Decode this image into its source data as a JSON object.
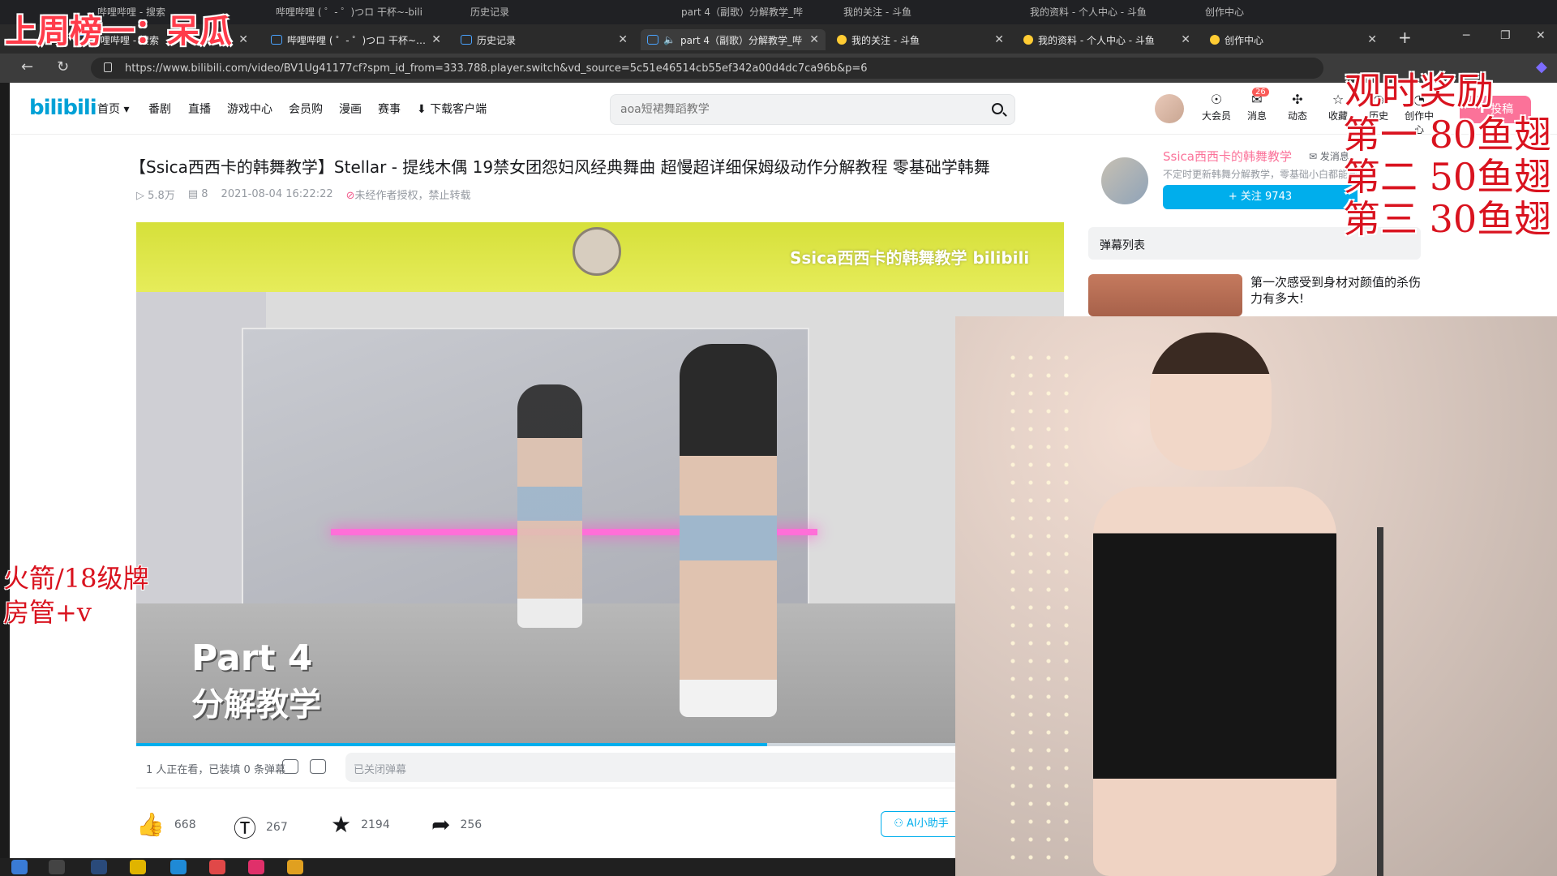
{
  "ghost_tabs": [
    "哔哩哔哩 - 搜索",
    "哔哩哔哩 ( ゜- ゜)つロ 干杯~-bili",
    "历史记录",
    "part 4（副歌）分解教学_哔",
    "我的关注 - 斗鱼",
    "我的资料 - 个人中心 - 斗鱼",
    "创作中心"
  ],
  "tabs": [
    {
      "label": "哔哩哔哩 - 搜索"
    },
    {
      "label": "哔哩哔哩 ( ゜- ゜)つロ 干杯~-bili"
    },
    {
      "label": "历史记录"
    },
    {
      "label": "part 4（副歌）分解教学_哔"
    },
    {
      "label": "我的关注 - 斗鱼"
    },
    {
      "label": "我的资料 - 个人中心 - 斗鱼"
    },
    {
      "label": "创作中心"
    }
  ],
  "address": {
    "url": "https://www.bilibili.com/video/BV1Ug41177cf?spm_id_from=333.788.player.switch&vd_source=5c51e46514cb55ef342a00d4dc7ca96b&p=6"
  },
  "header": {
    "logo": "bilibili",
    "nav": [
      "首页 ▾",
      "番剧",
      "直播",
      "游戏中心",
      "会员购",
      "漫画",
      "赛事",
      "下载客户端"
    ],
    "search_placeholder": "aoa短裙舞蹈教学",
    "icons": [
      {
        "label": "大会员",
        "icon": "vip-icon"
      },
      {
        "label": "消息",
        "icon": "message-icon"
      },
      {
        "label": "动态",
        "icon": "dynamic-icon"
      },
      {
        "label": "收藏",
        "icon": "star-icon"
      },
      {
        "label": "历史",
        "icon": "history-icon"
      },
      {
        "label": "创作中心",
        "icon": "creator-icon"
      }
    ],
    "message_badge": "26",
    "upload": "投稿"
  },
  "video": {
    "title": "【Ssica西西卡的韩舞教学】Stellar - 提线木偶 19禁女团怨妇风经典舞曲 超慢超详细保姆级动作分解教程 零基础学韩舞",
    "views": "5.8万",
    "danmaku": "8",
    "date": "2021-08-04 16:22:22",
    "notice": "未经作者授权，禁止转载",
    "watermark": "Ssica西西卡的韩舞教学 bilibili",
    "part_title": "Part 4",
    "part_sub": "分解教学",
    "progress": 0.68
  },
  "danmaku_bar": {
    "count_text": "1 人正在看，已装填 0 条弹幕",
    "input_placeholder": "已关闭弹幕"
  },
  "actions": {
    "like": "668",
    "coin": "267",
    "favorite": "2194",
    "share": "256",
    "ai": "AI小助手"
  },
  "uploader": {
    "name": "Ssica西西卡的韩舞教学",
    "message": "发消息",
    "desc": "不定时更新韩舞分解教学，零基础小白都能学",
    "follow": "+ 关注 9743"
  },
  "side": {
    "danmaku_list": "弹幕列表",
    "rec_title": "第一次感受到身材对颜值的杀伤力有多大!"
  },
  "overlays": {
    "top_left": "上周榜一：呆瓜",
    "reward_title": "观时奖励",
    "rank1": "第一 80鱼翅",
    "rank2": "第二 50鱼翅",
    "rank3": "第三 30鱼翅",
    "left1": "火箭/18级牌",
    "left2": "房管+v"
  }
}
